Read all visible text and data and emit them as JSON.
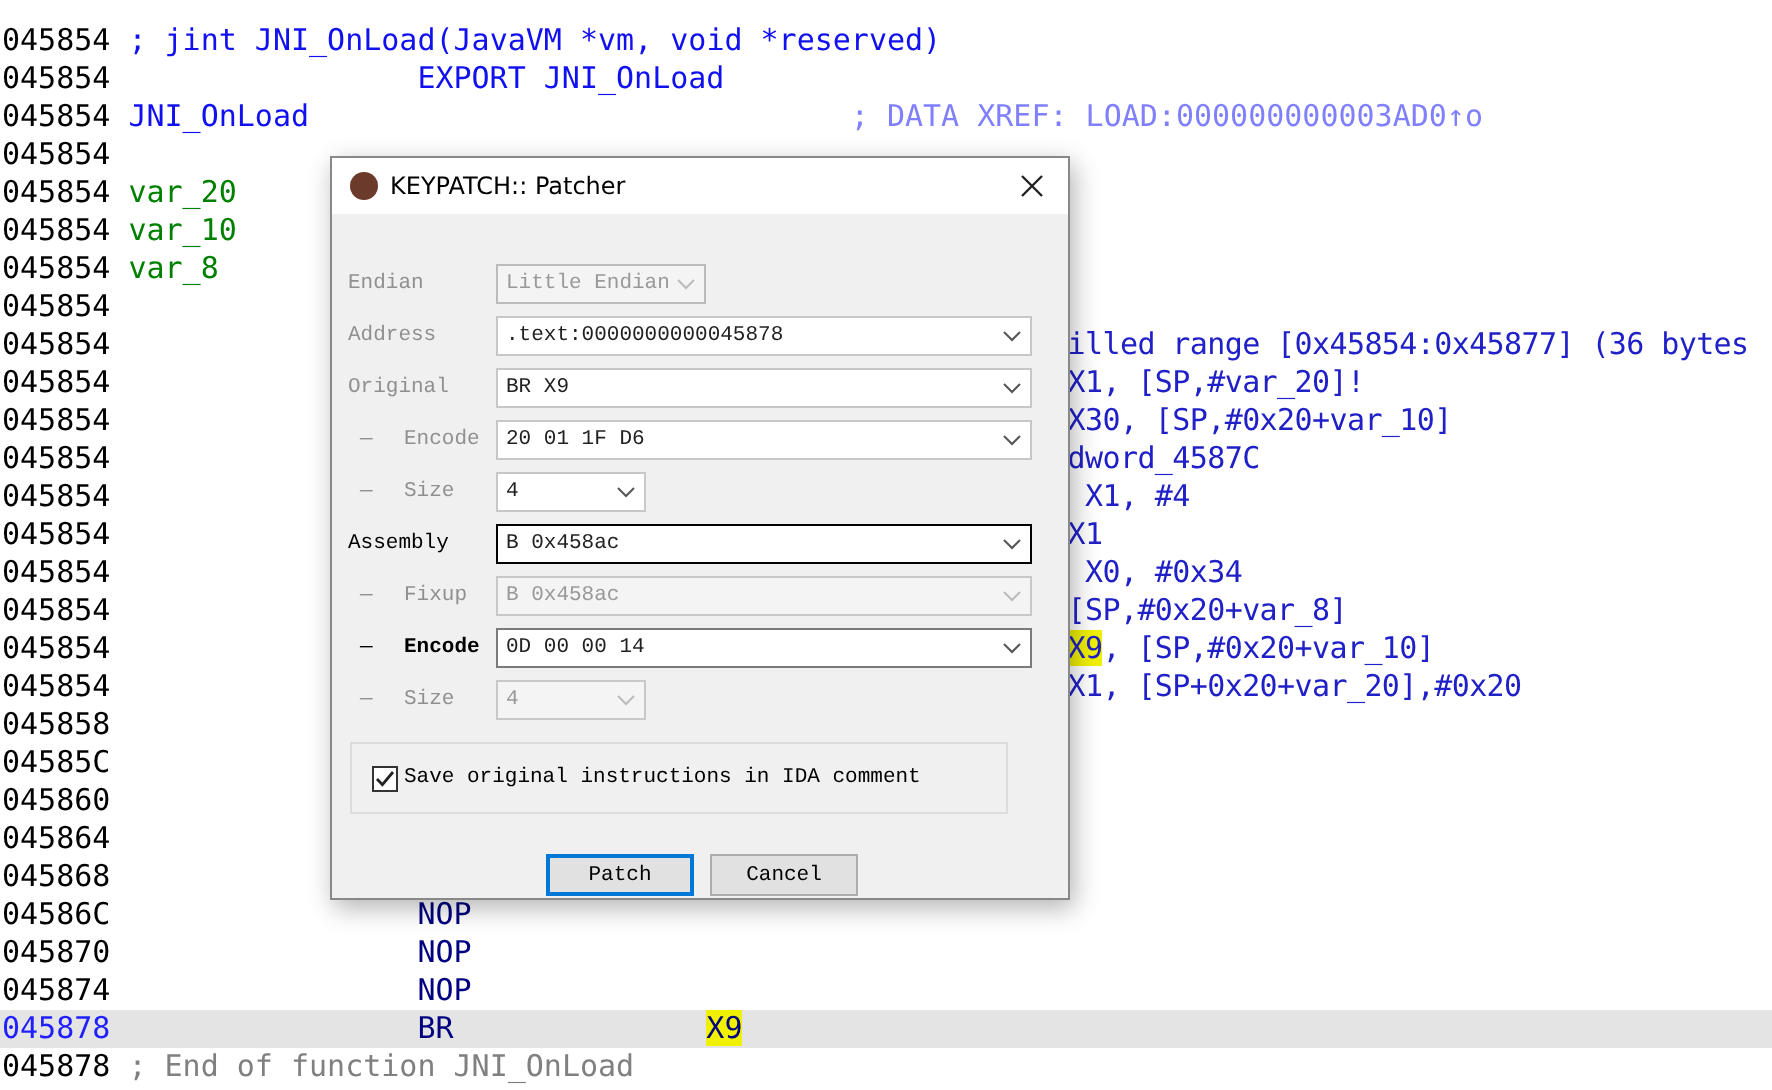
{
  "listing": [
    {
      "address": "045854",
      "selected": false,
      "parts": [
        {
          "kind": "header-comment",
          "text": "; jint JNI_OnLoad(JavaVM *vm, void *reserved)"
        }
      ]
    },
    {
      "address": "045854",
      "selected": false,
      "parts": [
        {
          "kind": "directive",
          "text": "EXPORT JNI_OnLoad"
        }
      ]
    },
    {
      "address": "045854",
      "selected": false,
      "parts": [
        {
          "kind": "label",
          "text": "JNI_OnLoad"
        },
        {
          "kind": "xref",
          "text": "; DATA XREF: LOAD:000000000003AD0↑o"
        }
      ]
    },
    {
      "address": "045854",
      "selected": false
    },
    {
      "address": "045854",
      "selected": false,
      "parts": [
        {
          "kind": "var",
          "text": "var_20"
        }
      ]
    },
    {
      "address": "045854",
      "selected": false,
      "parts": [
        {
          "kind": "var",
          "text": "var_10"
        }
      ]
    },
    {
      "address": "045854",
      "selected": false,
      "parts": [
        {
          "kind": "var",
          "text": "var_8"
        }
      ]
    },
    {
      "address": "045854",
      "selected": false
    },
    {
      "address": "045854",
      "selected": false,
      "parts": [
        {
          "kind": "fragment",
          "text": "illed range [0x45854:0x45877] (36 bytes"
        }
      ]
    },
    {
      "address": "045854",
      "selected": false,
      "parts": [
        {
          "kind": "fragment",
          "text": "X1, [SP,#var_20]!"
        }
      ]
    },
    {
      "address": "045854",
      "selected": false,
      "parts": [
        {
          "kind": "fragment",
          "text": "X30, [SP,#0x20+var_10]"
        }
      ]
    },
    {
      "address": "045854",
      "selected": false,
      "parts": [
        {
          "kind": "fragment",
          "text": "dword_4587C"
        }
      ]
    },
    {
      "address": "045854",
      "selected": false,
      "parts": [
        {
          "kind": "fragment",
          "text": " X1, #4"
        }
      ]
    },
    {
      "address": "045854",
      "selected": false,
      "parts": [
        {
          "kind": "fragment",
          "text": "X1"
        }
      ]
    },
    {
      "address": "045854",
      "selected": false,
      "parts": [
        {
          "kind": "fragment",
          "text": " X0, #0x34"
        }
      ]
    },
    {
      "address": "045854",
      "selected": false,
      "parts": [
        {
          "kind": "fragment",
          "text": "[SP,#0x20+var_8]"
        }
      ]
    },
    {
      "address": "045854",
      "selected": false,
      "parts": [
        {
          "kind": "fragment",
          "text": "X9",
          "highlighted": true
        },
        {
          "kind": "fragment",
          "text": ", [SP,#0x20+var_10]",
          "highlighted": false
        }
      ]
    },
    {
      "address": "045854",
      "selected": false,
      "parts": [
        {
          "kind": "fragment",
          "text": "X1, [SP+0x20+var_20],#0x20"
        }
      ]
    },
    {
      "address": "045858",
      "selected": false
    },
    {
      "address": "04585C",
      "selected": false
    },
    {
      "address": "045860",
      "selected": false
    },
    {
      "address": "045864",
      "selected": false
    },
    {
      "address": "045868",
      "selected": false
    },
    {
      "address": "04586C",
      "selected": false,
      "parts": [
        {
          "kind": "mnemonic",
          "text": "NOP"
        }
      ]
    },
    {
      "address": "045870",
      "selected": false,
      "parts": [
        {
          "kind": "mnemonic",
          "text": "NOP"
        }
      ]
    },
    {
      "address": "045874",
      "selected": false,
      "parts": [
        {
          "kind": "mnemonic",
          "text": "NOP"
        }
      ]
    },
    {
      "address": "045878",
      "selected": true,
      "parts": [
        {
          "kind": "mnemonic",
          "text": "BR"
        },
        {
          "kind": "operand",
          "text": "X9",
          "highlighted": true
        }
      ]
    },
    {
      "address": "045878",
      "selected": false,
      "parts": [
        {
          "kind": "end-comment",
          "text": "; End of function JNI_OnLoad"
        }
      ]
    }
  ],
  "dialog": {
    "title": "KEYPATCH:: Patcher",
    "fields": [
      {
        "label": "Endian",
        "value": "Little Endian",
        "kind": "selector",
        "greyed_label": true,
        "disabled": true,
        "bold": false,
        "focused": false
      },
      {
        "label": "Address",
        "value": ".text:0000000000045878",
        "kind": "combo",
        "greyed_label": true,
        "disabled": false,
        "bold": false,
        "focused": false
      },
      {
        "label": "Original",
        "value": "BR X9",
        "kind": "combo",
        "greyed_label": true,
        "disabled": false,
        "bold": false,
        "focused": false
      },
      {
        "dash": "—",
        "label": "Encode",
        "value": "20 01 1F D6",
        "kind": "combo",
        "greyed_label": true,
        "disabled": false,
        "bold": false,
        "focused": false
      },
      {
        "dash": "—",
        "label": "Size",
        "value": "4",
        "kind": "small-combo",
        "greyed_label": true,
        "disabled": false,
        "bold": false,
        "focused": false
      },
      {
        "label": "Assembly",
        "value": "B 0x458ac",
        "kind": "combo",
        "greyed_label": false,
        "disabled": false,
        "bold": false,
        "focused": true
      },
      {
        "dash": "—",
        "label": "Fixup",
        "value": "B 0x458ac",
        "kind": "combo",
        "greyed_label": true,
        "disabled": true,
        "bold": false,
        "focused": false
      },
      {
        "dash": "—",
        "label": "Encode",
        "value": "0D 00 00 14",
        "kind": "combo",
        "greyed_label": false,
        "disabled": false,
        "bold": true,
        "focused": false
      },
      {
        "dash": "—",
        "label": "Size",
        "value": "4",
        "kind": "small-combo",
        "greyed_label": true,
        "disabled": true,
        "bold": false,
        "focused": false
      }
    ],
    "checkbox": {
      "label": "Save original instructions in IDA comment",
      "checked": true
    },
    "buttons": [
      {
        "label": "Patch",
        "default": true
      },
      {
        "label": "Cancel",
        "default": false
      }
    ]
  }
}
